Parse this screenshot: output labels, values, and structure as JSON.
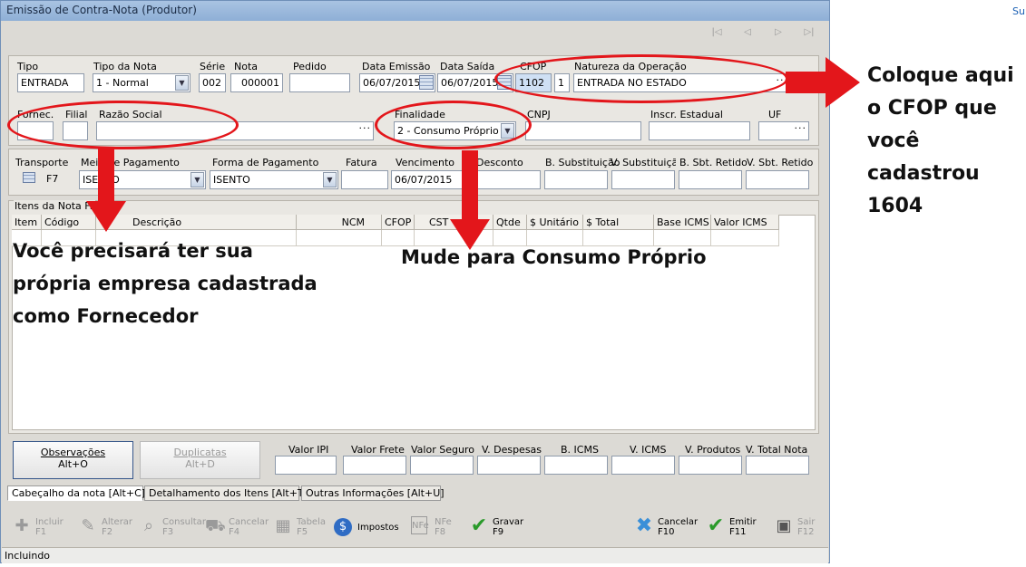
{
  "window": {
    "title": "Emissão de Contra-Nota (Produtor)",
    "corner_link": "Su"
  },
  "nav_icons": [
    "first-icon",
    "prev-icon",
    "next-icon",
    "last-icon"
  ],
  "header": {
    "tipo": {
      "label": "Tipo",
      "value": "ENTRADA"
    },
    "tipo_nota": {
      "label": "Tipo da Nota",
      "value": "1 - Normal"
    },
    "serie": {
      "label": "Série",
      "value": "002"
    },
    "nota": {
      "label": "Nota",
      "value": "000001"
    },
    "pedido": {
      "label": "Pedido",
      "value": ""
    },
    "data_emissao": {
      "label": "Data Emissão",
      "value": "06/07/2015"
    },
    "data_saida": {
      "label": "Data Saída",
      "value": "06/07/2015"
    },
    "cfop": {
      "label": "CFOP",
      "value": "1102",
      "seq": "1"
    },
    "natureza": {
      "label": "Natureza da Operação",
      "value": "ENTRADA NO ESTADO"
    }
  },
  "supplier": {
    "fornec_label": "Fornec.",
    "filial_label": "Filial",
    "razao_label": "Razão Social",
    "finalidade": {
      "label": "Finalidade",
      "value": "2 - Consumo Próprio"
    },
    "cnpj_label": "CNPJ",
    "inscr_label": "Inscr. Estadual",
    "uf_label": "UF"
  },
  "payment": {
    "transporte_label": "Transporte",
    "transporte_key": "F7",
    "meio_label": "Meio de Pagamento",
    "meio_value": "ISENTO",
    "forma_label": "Forma de Pagamento",
    "forma_value": "ISENTO",
    "fatura_label": "Fatura",
    "vencimento": {
      "label": "Vencimento",
      "value": "06/07/2015"
    },
    "desconto_label": "Desconto",
    "bsub_label": "B. Substituição",
    "vsub_label": "V. Substituição",
    "bsbt_label": "B. Sbt. Retido",
    "vsbt_label": "V. Sbt. Retido"
  },
  "items": {
    "group_label": "Itens da Nota Fiscal",
    "columns": [
      "Item",
      "Código",
      "Descrição",
      "NCM",
      "CFOP",
      "CST",
      "Qtde",
      "$ Unitário",
      "$ Total",
      "Base ICMS",
      "Valor ICMS"
    ]
  },
  "footer_buttons": {
    "observacoes": "Observações",
    "observacoes_key": "Alt+O",
    "duplicatas": "Duplicatas",
    "duplicatas_key": "Alt+D"
  },
  "totals": [
    "Valor IPI",
    "Valor Frete",
    "Valor Seguro",
    "V. Despesas",
    "B. ICMS",
    "V. ICMS",
    "V. Produtos",
    "V. Total Nota"
  ],
  "tabs": [
    {
      "label": "Cabeçalho da nota  [Alt+C]"
    },
    {
      "label": "Detalhamento dos Itens  [Alt+T]"
    },
    {
      "label": "Outras Informações  [Alt+U]"
    }
  ],
  "toolbar": [
    {
      "label": "Incluir",
      "key": "F1"
    },
    {
      "label": "Alterar",
      "key": "F2"
    },
    {
      "label": "Consultar",
      "key": "F3"
    },
    {
      "label": "Cancelar",
      "key": "F4"
    },
    {
      "label": "Tabela",
      "key": "F5"
    },
    {
      "label": "Impostos",
      "key": ""
    },
    {
      "label": "NFe",
      "key": "F8"
    },
    {
      "label": "Gravar",
      "key": "F9"
    },
    {
      "label": "Cancelar",
      "key": "F10"
    },
    {
      "label": "Emitir",
      "key": "F11"
    },
    {
      "label": "Sair",
      "key": "F12"
    }
  ],
  "status": "Incluindo",
  "annotations": {
    "cfop_note": [
      "Coloque aqui",
      "o CFOP que",
      "você",
      "cadastrou",
      "1604"
    ],
    "fornecedor_note": [
      "Você precisará ter sua",
      "própria empresa cadastrada",
      "como Fornecedor"
    ],
    "finalidade_note": "Mude para Consumo Próprio",
    "color": "#e3161b"
  }
}
